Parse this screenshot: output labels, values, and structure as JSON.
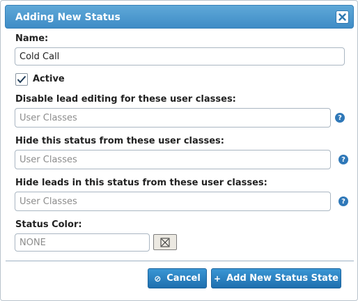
{
  "dialog": {
    "title": "Adding New Status",
    "close_icon": "close-icon"
  },
  "form": {
    "name_label": "Name:",
    "name_value": "Cold Call",
    "active_label": "Active",
    "active_checked": true,
    "disable_label": "Disable lead editing for these user classes:",
    "disable_placeholder": "User Classes",
    "hide_status_label": "Hide this status from these user classes:",
    "hide_status_placeholder": "User Classes",
    "hide_leads_label": "Hide leads in this status from these user classes:",
    "hide_leads_placeholder": "User Classes",
    "color_label": "Status Color:",
    "color_value": "NONE",
    "help_glyph": "?"
  },
  "buttons": {
    "cancel_label": "Cancel",
    "cancel_icon": "⊘",
    "add_label": "Add New Status State",
    "add_icon": "+"
  },
  "colors": {
    "titlebar": "#3f8cc6",
    "button": "#1f6fae",
    "help": "#2f78b8"
  }
}
